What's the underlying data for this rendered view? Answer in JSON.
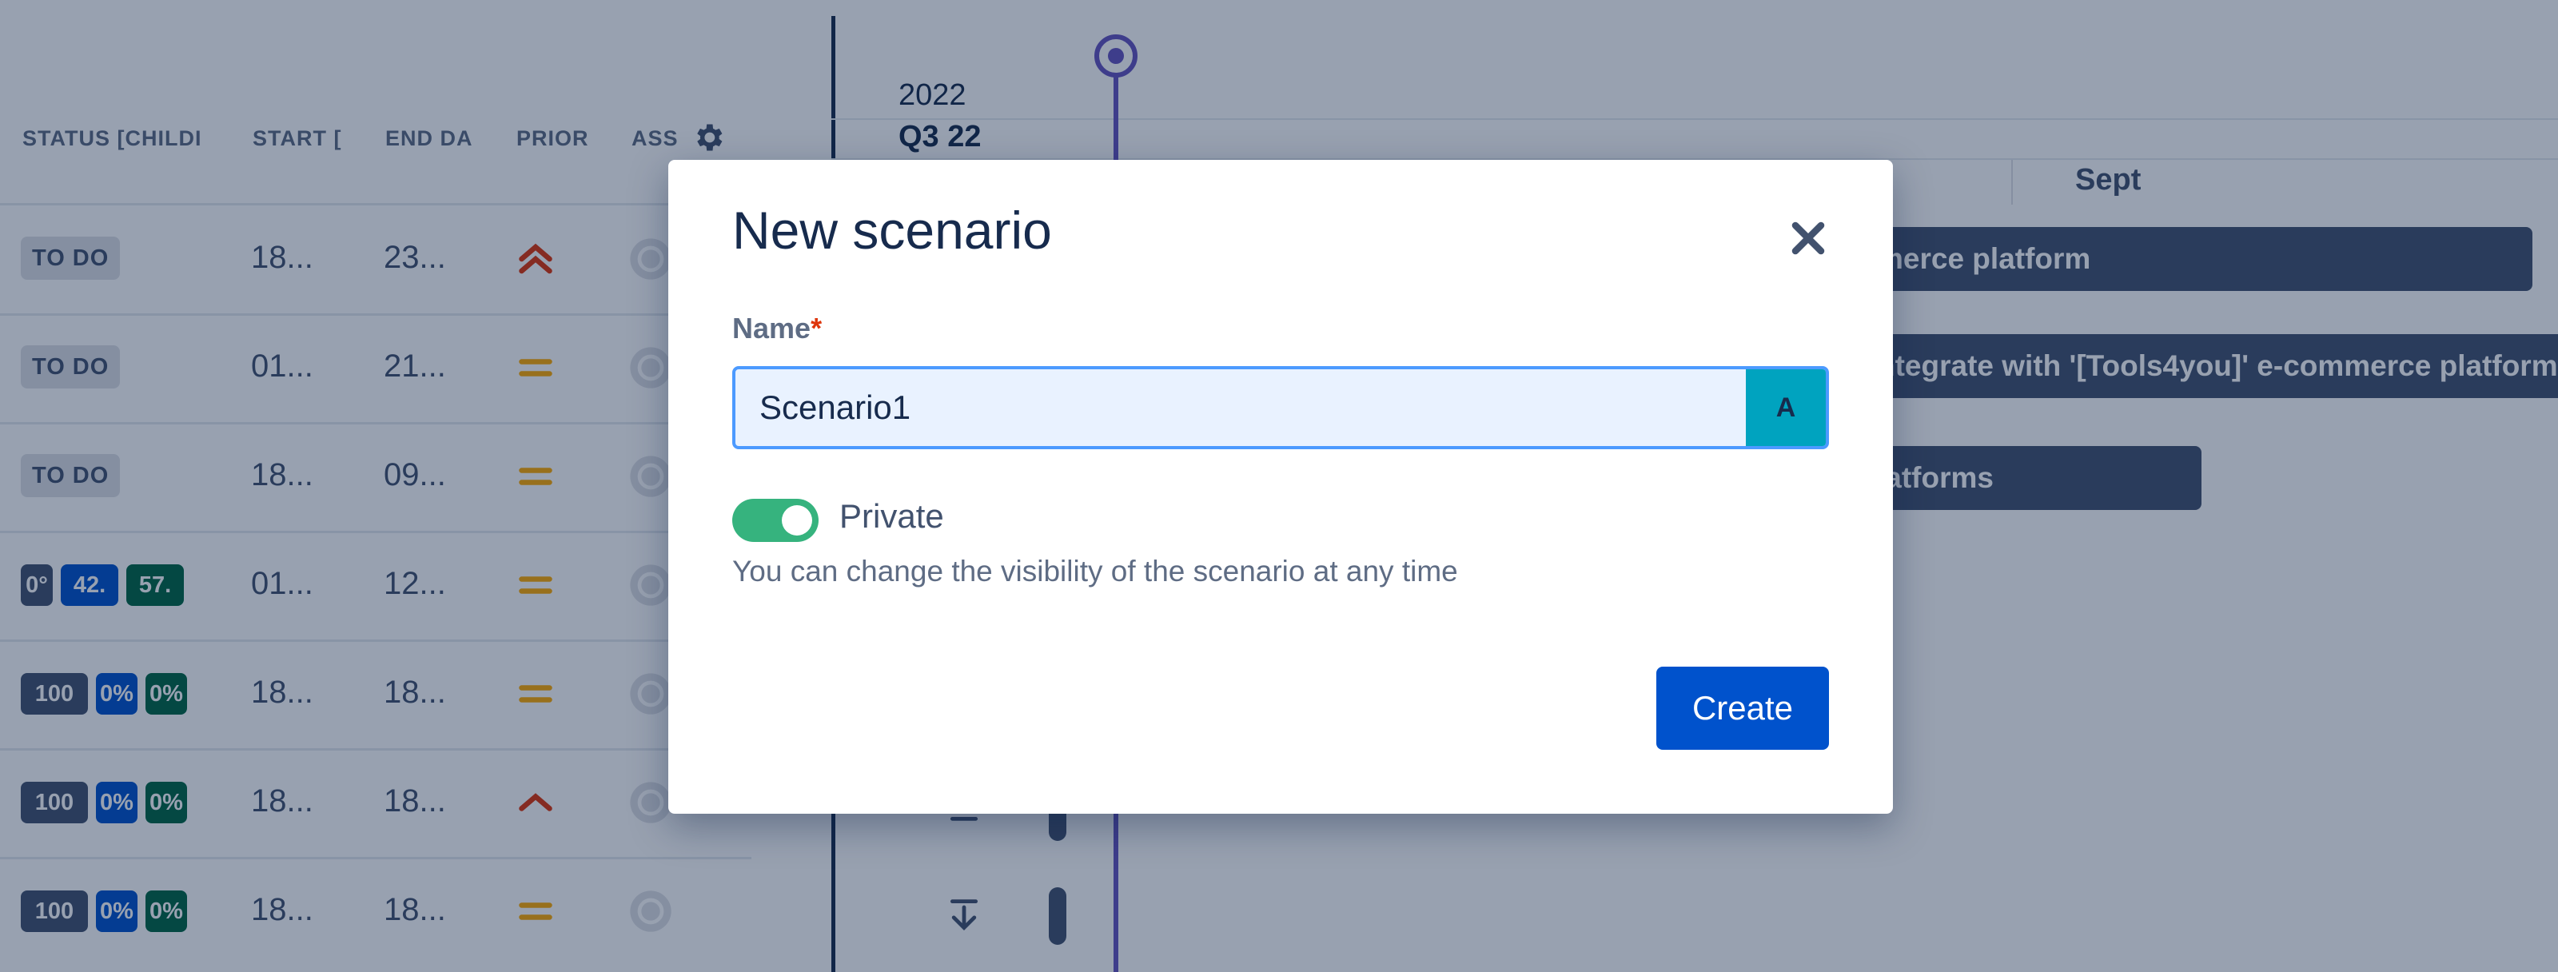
{
  "table": {
    "headers": [
      "STATUS [CHILDI",
      "START [",
      "END DA",
      "PRIOR",
      "ASS"
    ],
    "rows": [
      {
        "status": "TO DO",
        "start": "18...",
        "end": "23...",
        "priority": "highest"
      },
      {
        "status": "TO DO",
        "start": "01...",
        "end": "21...",
        "priority": "medium"
      },
      {
        "status": "TO DO",
        "start": "18...",
        "end": "09...",
        "priority": "medium"
      },
      {
        "progress": [
          "0°",
          "42.",
          "57."
        ],
        "start": "01...",
        "end": "12...",
        "priority": "medium"
      },
      {
        "progress": [
          "100",
          "0%",
          "0%"
        ],
        "start": "18...",
        "end": "18...",
        "priority": "medium"
      },
      {
        "progress": [
          "100",
          "0%",
          "0%"
        ],
        "start": "18...",
        "end": "18...",
        "priority": "high"
      },
      {
        "progress": [
          "100",
          "0%",
          "0%"
        ],
        "start": "18...",
        "end": "18...",
        "priority": "medium"
      }
    ]
  },
  "timeline": {
    "year": "2022",
    "quarter": "Q3 22",
    "month": "Sept",
    "bars": [
      "merce platform",
      "ntegrate with '[Tools4you]' e-commerce platform",
      "latforms"
    ]
  },
  "dialog": {
    "title": "New scenario",
    "name_label": "Name",
    "required_mark": "*",
    "name_value": "Scenario1",
    "name_badge": "A",
    "toggle_label": "Private",
    "toggle_on": true,
    "hint": "You can change the visibility of the scenario at any time",
    "create_label": "Create"
  },
  "colors": {
    "primary": "#0052cc",
    "toggle_on": "#36b37e",
    "today_line": "#6554c0",
    "required": "#de350b",
    "priority_highest": "#de350b",
    "priority_medium": "#ffab00",
    "progress_done": "#42526e",
    "progress_inprogress": "#0052cc",
    "progress_todo": "#006644"
  }
}
